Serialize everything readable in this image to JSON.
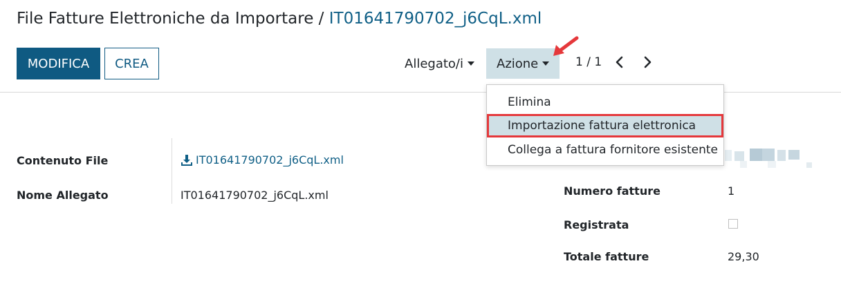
{
  "breadcrumb": {
    "parent": "File Fatture Elettroniche da Importare",
    "separator": "/",
    "current": "IT01641790702_j6CqL.xml"
  },
  "toolbar": {
    "edit_label": "MODIFICA",
    "create_label": "CREA",
    "attachments_label": "Allegato/i",
    "action_label": "Azione",
    "pager": "1 / 1"
  },
  "action_menu": {
    "items": [
      {
        "label": "Elimina"
      },
      {
        "label": "Importazione fattura elettronica",
        "highlighted": true
      },
      {
        "label": "Collega a fattura fornitore esistente"
      }
    ]
  },
  "form": {
    "left": [
      {
        "label": "Contenuto File",
        "value": "IT01641790702_j6CqL.xml"
      },
      {
        "label": "Nome Allegato",
        "value": "IT01641790702_j6CqL.xml"
      }
    ],
    "right": [
      {
        "label": "Numero fatture",
        "value": "1"
      },
      {
        "label": "Registrata",
        "value": ""
      },
      {
        "label": "Totale fatture",
        "value": "29,30"
      }
    ]
  },
  "colors": {
    "primary": "#0f5a82",
    "link": "#0f5f86",
    "highlight": "#cfe0e6",
    "annotation_red": "#e5383b"
  },
  "icons": [
    "chevron-left-icon",
    "chevron-right-icon",
    "download-icon",
    "caret-down-icon",
    "pointer-arrow-icon"
  ]
}
